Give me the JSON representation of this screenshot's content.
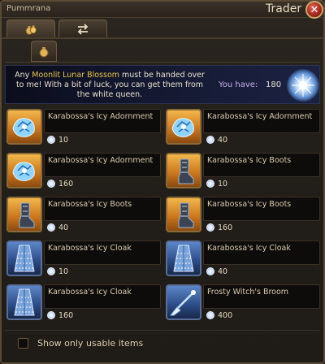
{
  "window": {
    "title_left": "Pummrana",
    "title": "Trader",
    "close": "✕"
  },
  "tabs": [
    {
      "icon": "coin-bags-icon",
      "active": true
    },
    {
      "icon": "exchange-arrows-icon",
      "active": false
    }
  ],
  "subtab": {
    "icon": "coin-bag-icon"
  },
  "info": {
    "text_pre": "Any ",
    "highlight": "Moonlit Lunar Blossom",
    "text_post": " must be handed over to me! With a bit of luck, you can get them from the white queen.",
    "you_have_label": "You have:",
    "you_have_value": "180"
  },
  "items": [
    {
      "name": "Karabossa's Icy Adornment",
      "price": "10",
      "kind": "adornment"
    },
    {
      "name": "Karabossa's Icy Adornment",
      "price": "40",
      "kind": "adornment"
    },
    {
      "name": "Karabossa's Icy Adornment",
      "price": "160",
      "kind": "adornment"
    },
    {
      "name": "Karabossa's Icy Boots",
      "price": "10",
      "kind": "boots"
    },
    {
      "name": "Karabossa's Icy Boots",
      "price": "40",
      "kind": "boots"
    },
    {
      "name": "Karabossa's Icy Boots",
      "price": "160",
      "kind": "boots"
    },
    {
      "name": "Karabossa's Icy Cloak",
      "price": "10",
      "kind": "cloak"
    },
    {
      "name": "Karabossa's Icy Cloak",
      "price": "40",
      "kind": "cloak"
    },
    {
      "name": "Karabossa's Icy Cloak",
      "price": "160",
      "kind": "cloak"
    },
    {
      "name": "Frosty Witch's Broom",
      "price": "400",
      "kind": "broom"
    }
  ],
  "footer": {
    "checkbox_label": "Show only usable items",
    "checked": false
  }
}
